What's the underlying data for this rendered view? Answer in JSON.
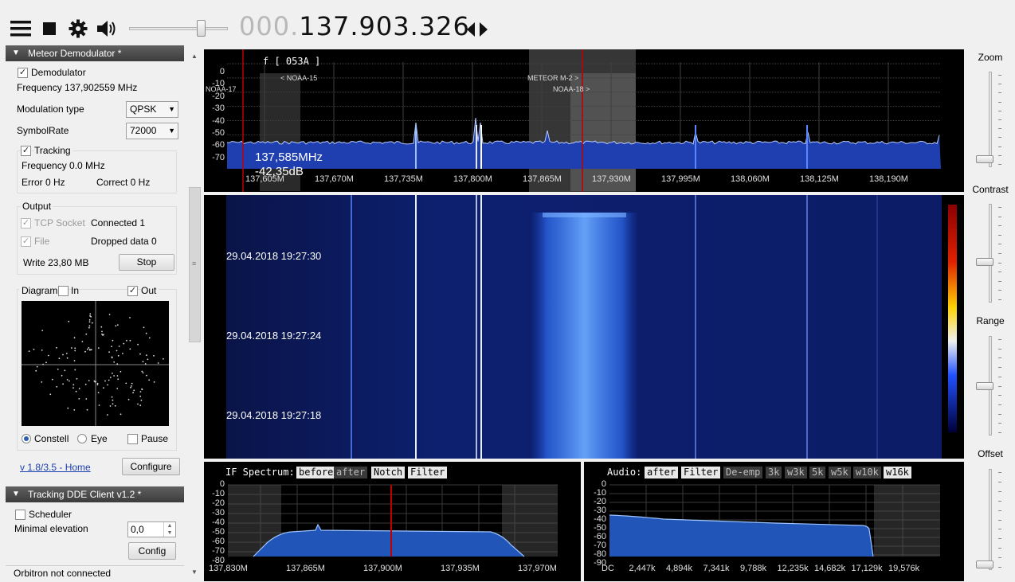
{
  "toolbar": {
    "icons": [
      "menu-icon",
      "stop-icon",
      "gear-icon",
      "speaker-icon"
    ],
    "volume_level": 0.72,
    "freq_prefix": "000.",
    "freq_main": "137.903.326"
  },
  "meteor": {
    "title": "Meteor Demodulator *",
    "demodulator_label": "Demodulator",
    "frequency_text": "Frequency 137,902559 MHz",
    "modulation_label": "Modulation type",
    "modulation_value": "QPSK",
    "symbolrate_label": "SymbolRate",
    "symbolrate_value": "72000",
    "tracking_label": "Tracking",
    "tracking_freq": "Frequency 0.0 MHz",
    "error": "Error 0 Hz",
    "correct": "Correct 0 Hz",
    "output_label": "Output",
    "tcp_label": "TCP Socket",
    "tcp_status": "Connected 1",
    "file_label": "File",
    "dropped": "Dropped data 0",
    "write": "Write 23,80 MB",
    "stop_label": "Stop",
    "diagram_label": "Diagram",
    "in_label": "In",
    "out_label": "Out",
    "constell_label": "Constell",
    "eye_label": "Eye",
    "pause_label": "Pause",
    "version_link": "v 1.8/3.5 - Home",
    "configure_label": "Configure"
  },
  "tracking": {
    "title": "Tracking DDE Client v1.2 *",
    "scheduler_label": "Scheduler",
    "min_elev_label": "Minimal elevation",
    "min_elev_value": "0,0",
    "config_label": "Config",
    "orbitron": "Orbitron not connected"
  },
  "spectrum": {
    "label": "f [ 053A ]",
    "cursor_freq": "137,585MHz",
    "cursor_db": "-42,35dB",
    "y_ticks": [
      "0",
      "-10",
      "-20",
      "-30",
      "-40",
      "-50",
      "-60",
      "-70"
    ],
    "x_ticks": [
      "137,605M",
      "137,670M",
      "137,735M",
      "137,800M",
      "137,865M",
      "137,930M",
      "137,995M",
      "138,060M",
      "138,125M",
      "138,190M"
    ],
    "sat_labels": [
      "NOAA-17",
      "< NOAA-15",
      "METEOR M-2 >",
      "NOAA-18 >"
    ]
  },
  "waterfall": {
    "timestamps": [
      "29.04.2018 19:27:30",
      "29.04.2018 19:27:24",
      "29.04.2018 19:27:18"
    ]
  },
  "if_spectrum": {
    "title": "IF Spectrum:",
    "tags": [
      "before",
      "after",
      "Notch",
      "Filter"
    ],
    "y_ticks": [
      "0",
      "-10",
      "-20",
      "-30",
      "-40",
      "-50",
      "-60",
      "-70",
      "-80"
    ],
    "x_ticks": [
      "137,830M",
      "137,865M",
      "137,900M",
      "137,935M",
      "137,970M"
    ]
  },
  "audio": {
    "title": "Audio:",
    "tags": [
      "after",
      "Filter",
      "De-emp",
      "3k",
      "w3k",
      "5k",
      "w5k",
      "w10k",
      "w16k"
    ],
    "y_ticks": [
      "0",
      "-10",
      "-20",
      "-30",
      "-40",
      "-50",
      "-60",
      "-70",
      "-80",
      "-90"
    ],
    "x_ticks": [
      "DC",
      "2,447k",
      "4,894k",
      "7,341k",
      "9,788k",
      "12,235k",
      "14,682k",
      "17,129k",
      "19,576k"
    ]
  },
  "sliders": {
    "zoom_label": "Zoom",
    "contrast_label": "Contrast",
    "range_label": "Range",
    "offset_label": "Offset",
    "zoom_level": 0.05,
    "contrast_level": 0.4,
    "range_level": 0.5,
    "offset_level": 0.02
  },
  "colors": {
    "spectrum_fill": "#1f3fb0",
    "waterfall_bg": "#0a1a5a",
    "signal": "#6aa8ff",
    "marker_red": "#c00000"
  }
}
